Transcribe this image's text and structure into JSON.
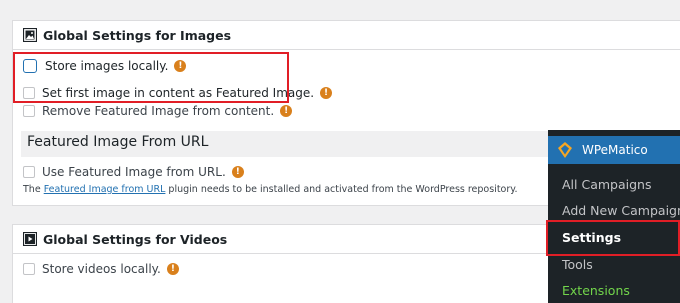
{
  "images_panel": {
    "title": "Global Settings for Images",
    "options": [
      {
        "label": "Store images locally.",
        "warning": "!",
        "checked": false
      },
      {
        "label": "Set first image in content as Featured Image.",
        "warning": "!",
        "checked": false
      },
      {
        "label": "Remove Featured Image from content.",
        "warning": "!",
        "checked": false
      }
    ],
    "featured_url_heading": "Featured Image From URL",
    "featured_url_option": {
      "label": "Use Featured Image from URL.",
      "warning": "!",
      "checked": false
    },
    "note": {
      "prefix": "The ",
      "link": "Featured Image from URL",
      "suffix": " plugin needs to be installed and activated from the WordPress repository."
    }
  },
  "videos_panel": {
    "title": "Global Settings for Videos",
    "options": [
      {
        "label": "Store videos locally.",
        "warning": "!",
        "checked": false
      }
    ]
  },
  "admin_menu": {
    "brand": "WPeMatico",
    "items": [
      {
        "label": "All Campaigns"
      },
      {
        "label": "Add New Campaign"
      },
      {
        "label": "Settings",
        "active": true
      },
      {
        "label": "Tools"
      },
      {
        "label": "Extensions",
        "accent": "#72d54b"
      }
    ]
  },
  "colors": {
    "highlight": "#e11e26",
    "warning": "#d9801c",
    "menu_bg": "#1d2327",
    "brand_bg": "#2271b1"
  }
}
